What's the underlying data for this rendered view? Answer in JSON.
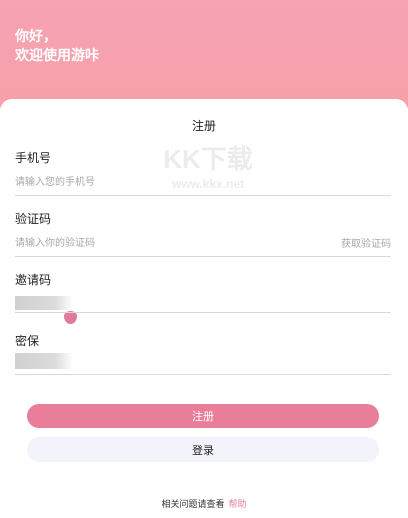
{
  "header": {
    "greeting_line1": "你好，",
    "greeting_line2": "欢迎使用游咔"
  },
  "card": {
    "title": "注册"
  },
  "phone": {
    "label": "手机号",
    "placeholder": "请输入您的手机号"
  },
  "code": {
    "label": "验证码",
    "placeholder": "请输入你的验证码",
    "get_code": "获取验证码"
  },
  "invite": {
    "label": "邀请码"
  },
  "password": {
    "label": "密保"
  },
  "buttons": {
    "register": "注册",
    "login": "登录"
  },
  "footer": {
    "help_prefix": "相关问题请查看",
    "help_link": "帮助"
  },
  "watermark": {
    "logo_text": "KK下载",
    "url": "www.kkx.net"
  },
  "colors": {
    "accent": "#e87e9a",
    "header_bg": "#f6a3b4",
    "login_bg": "#f3f3fb"
  }
}
